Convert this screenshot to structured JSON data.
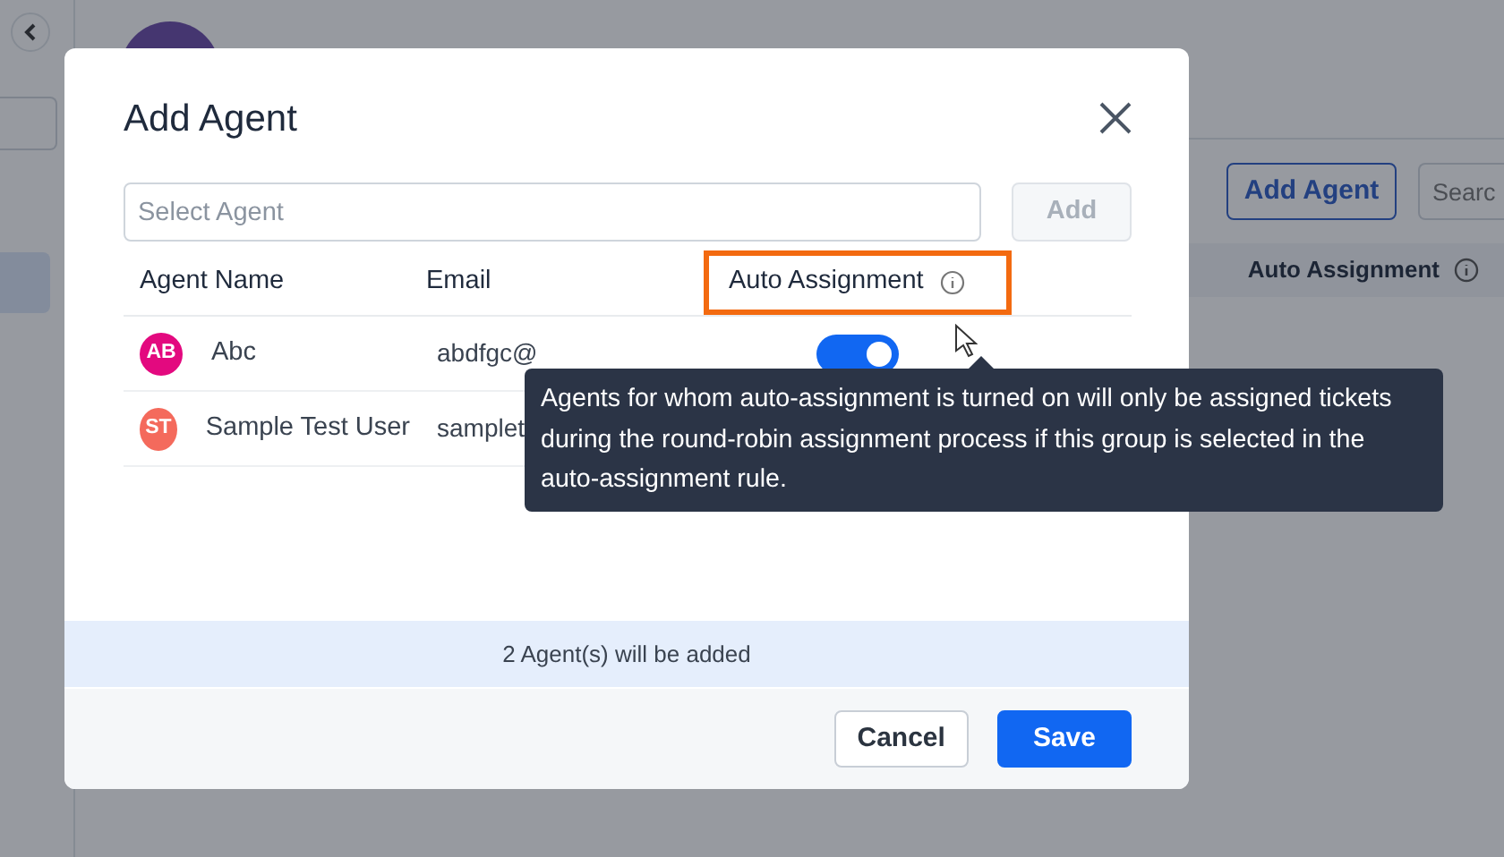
{
  "background": {
    "add_agent_button": "Add Agent",
    "search": {
      "placeholder": "Searc"
    },
    "column_header": "Auto Assignment"
  },
  "modal": {
    "title": "Add Agent",
    "select": {
      "placeholder": "Select Agent"
    },
    "add_button": {
      "label": "Add",
      "disabled": true
    },
    "columns": [
      {
        "label": "Agent Name",
        "highlighted": false
      },
      {
        "label": "Email",
        "highlighted": false
      },
      {
        "label": "Auto Assignment",
        "highlighted": true
      }
    ],
    "rows": [
      {
        "initials": "AB",
        "color": "#e3097f",
        "name": "Abc",
        "email": "abdfgc@",
        "auto_assignment_on": true
      },
      {
        "initials": "ST",
        "color": "#f46a5c",
        "name": "Sample Test User",
        "email": "samplet"
      }
    ],
    "summary": "2 Agent(s) will be added",
    "buttons": [
      {
        "label": "Cancel",
        "kind": "secondary"
      },
      {
        "label": "Save",
        "kind": "primary"
      }
    ]
  },
  "tooltip": {
    "text": "Agents for whom auto-assignment is turned on will only be assigned tickets during the round-robin assignment process if this group is selected in the auto-assignment rule."
  }
}
